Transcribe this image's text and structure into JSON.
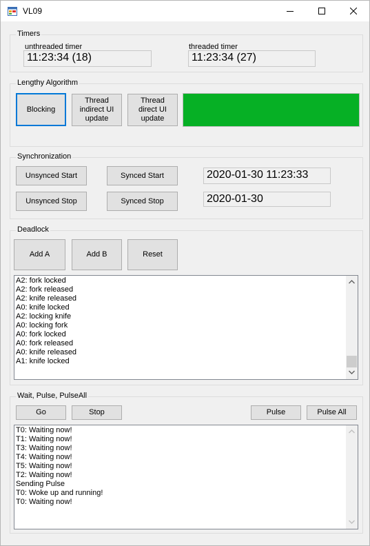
{
  "window": {
    "title": "VL09"
  },
  "timers": {
    "caption": "Timers",
    "unthreaded_label": "unthreaded timer",
    "unthreaded_value": "11:23:34 (18)",
    "threaded_label": "threaded timer",
    "threaded_value": "11:23:34 (27)"
  },
  "lengthy": {
    "caption": "Lengthy Algorithm",
    "blocking": "Blocking",
    "thread_indirect_l1": "Thread",
    "thread_indirect_l2": "indirect UI",
    "thread_indirect_l3": "update",
    "thread_direct_l1": "Thread",
    "thread_direct_l2": "direct UI",
    "thread_direct_l3": "update",
    "progress_fraction": 1.0,
    "progress_color": "#06b025"
  },
  "sync": {
    "caption": "Synchronization",
    "unsynced_start": "Unsynced Start",
    "synced_start": "Synced Start",
    "unsynced_stop": "Unsynced Stop",
    "synced_stop": "Synced Stop",
    "datetime_value": "2020-01-30 11:23:33",
    "date_value": "2020-01-30"
  },
  "deadlock": {
    "caption": "Deadlock",
    "add_a": "Add A",
    "add_b": "Add B",
    "reset": "Reset",
    "log": [
      "A2: fork locked",
      "A2: fork released",
      "A2: knife released",
      "A0: knife locked",
      "A2: locking knife",
      "A0: locking fork",
      "A0: fork locked",
      "A0: fork released",
      "A0: knife released",
      "A1: knife locked"
    ]
  },
  "wait": {
    "caption": "Wait, Pulse, PulseAll",
    "go": "Go",
    "stop": "Stop",
    "pulse": "Pulse",
    "pulse_all": "Pulse All",
    "log": [
      "T0: Waiting now!",
      "T1: Waiting now!",
      "T3: Waiting now!",
      "T4: Waiting now!",
      "T5: Waiting now!",
      "T2: Waiting now!",
      "Sending Pulse",
      "T0: Woke up and running!",
      "T0: Waiting now!"
    ]
  }
}
